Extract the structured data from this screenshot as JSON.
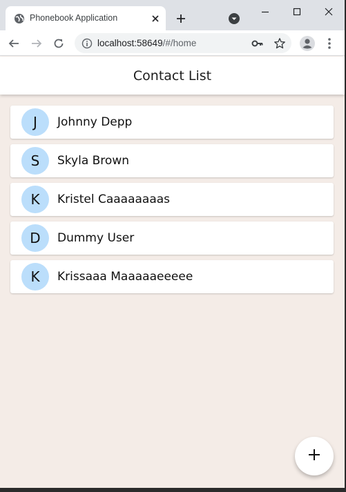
{
  "browser": {
    "tab": {
      "title": "Phonebook Application",
      "favicon": "globe-icon"
    },
    "window_controls": [
      "minimize-icon",
      "maximize-icon",
      "close-icon"
    ],
    "address_bar": {
      "host": "localhost:58649",
      "path": "/#/home"
    },
    "toolbar_icons": [
      "back-arrow-icon",
      "forward-arrow-icon",
      "reload-icon",
      "info-icon",
      "key-icon",
      "star-icon",
      "profile-icon",
      "more-vert-icon"
    ]
  },
  "app": {
    "title": "Contact List",
    "contacts": [
      {
        "initial": "J",
        "name": "Johnny Depp"
      },
      {
        "initial": "S",
        "name": "Skyla Brown"
      },
      {
        "initial": "K",
        "name": "Kristel Caaaaaaaas"
      },
      {
        "initial": "D",
        "name": "Dummy User"
      },
      {
        "initial": "K",
        "name": "Krissaaa Maaaaaeeeee"
      }
    ],
    "fab_icon": "plus-icon"
  },
  "colors": {
    "page_background": "#f4ece7",
    "avatar_background": "#bbdefb",
    "tabstrip": "#dee1e6"
  }
}
